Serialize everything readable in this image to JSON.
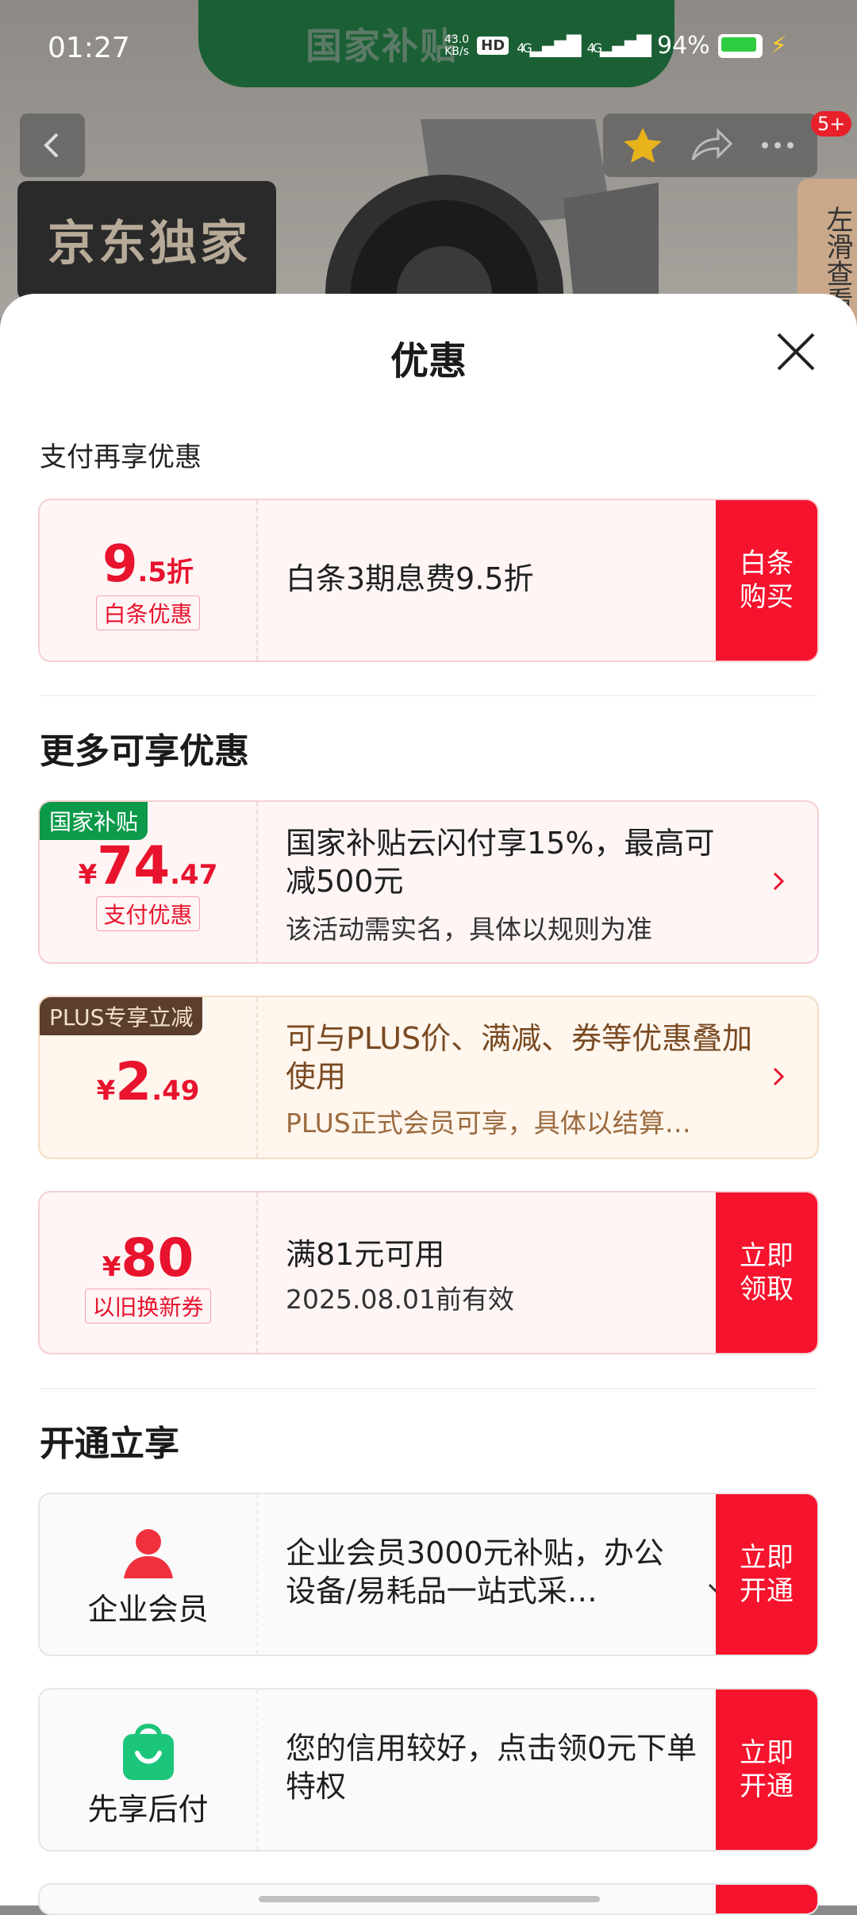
{
  "status": {
    "time": "01:27",
    "net_speed_top": "43.0",
    "net_speed_bottom": "KB/s",
    "hd": "HD",
    "net_type_1": "4G",
    "net_type_2": "4G",
    "battery": "94%"
  },
  "background": {
    "banner_text": "国家补贴",
    "exclusive_text": "京东独家",
    "badge": "5+",
    "swipe_hint": "左滑查看"
  },
  "sheet": {
    "title": "优惠",
    "section_pay": "支付再享优惠",
    "section_more": "更多可享优惠",
    "section_open": "开通立享"
  },
  "cards": {
    "baitiao": {
      "num": "9",
      "num_suffix": ".5折",
      "label": "白条优惠",
      "title": "白条3期息费9.5折",
      "btn": "白条购买"
    },
    "subsidy": {
      "tag": "国家补贴",
      "currency": "¥",
      "num": "74",
      "decimal": ".47",
      "label": "支付优惠",
      "title": "国家补贴云闪付享15%，最高可减500元",
      "sub": "该活动需实名，具体以规则为准"
    },
    "plus": {
      "tag": "PLUS专享立减",
      "currency": "¥",
      "num": "2",
      "decimal": ".49",
      "title": "可与PLUS价、满减、券等优惠叠加使用",
      "sub": "PLUS正式会员可享，具体以结算…"
    },
    "coupon": {
      "currency": "¥",
      "num": "80",
      "label": "以旧换新券",
      "title": "满81元可用",
      "sub": "2025.08.01前有效",
      "btn": "立即领取"
    },
    "enterprise": {
      "name": "企业会员",
      "title": "企业会员3000元补贴，办公设备/易耗品一站式采…",
      "btn": "立即开通"
    },
    "paylater": {
      "name": "先享后付",
      "title": "您的信用较好，点击领0元下单特权",
      "btn": "立即开通"
    }
  },
  "colors": {
    "accent_red": "#f5132d",
    "subsidy_green": "#0c9a4a",
    "plus_brown": "#5b3f2c"
  }
}
